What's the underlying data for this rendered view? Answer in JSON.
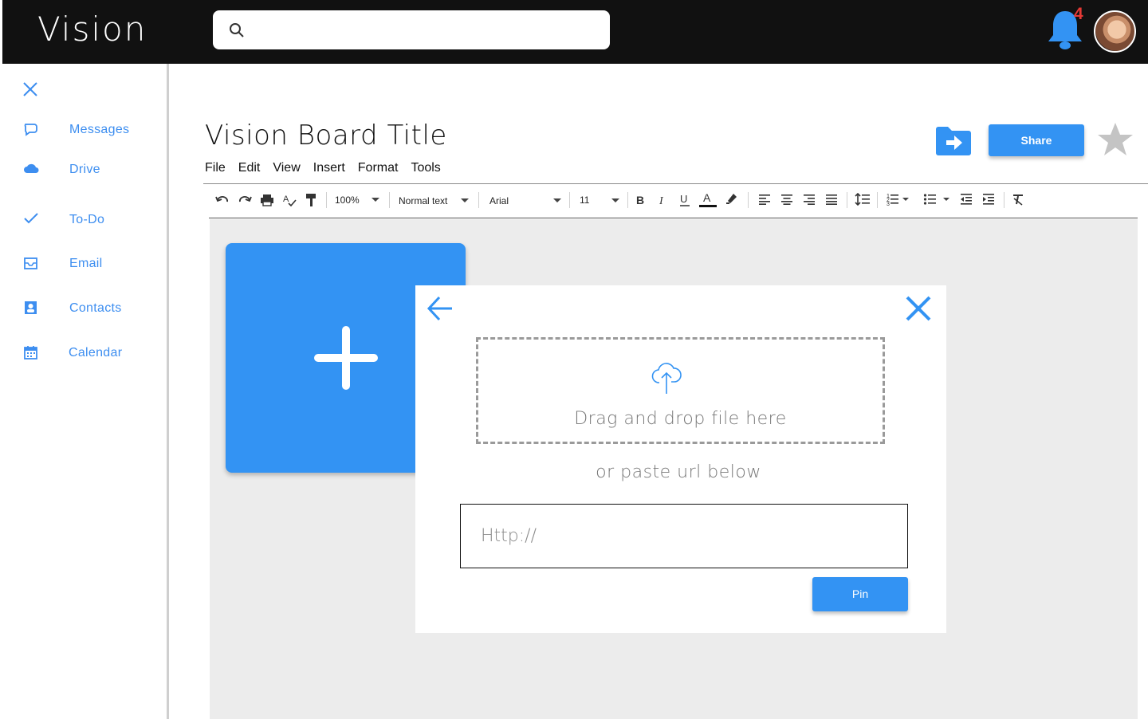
{
  "app": {
    "logo": "Vision",
    "notification_count": "4"
  },
  "search": {
    "placeholder": ""
  },
  "sidebar": {
    "items": [
      {
        "label": "Messages",
        "icon": "chat-icon"
      },
      {
        "label": "Drive",
        "icon": "cloud-icon"
      },
      {
        "label": "To-Do",
        "icon": "check-icon"
      },
      {
        "label": "Email",
        "icon": "inbox-icon"
      },
      {
        "label": "Contacts",
        "icon": "contact-card-icon"
      },
      {
        "label": "Calendar",
        "icon": "calendar-icon"
      }
    ]
  },
  "document": {
    "title": "Vision Board Title",
    "menu": [
      "File",
      "Edit",
      "View",
      "Insert",
      "Format",
      "Tools"
    ],
    "share_label": "Share"
  },
  "toolbar": {
    "zoom": "100%",
    "style": "Normal text",
    "font": "Arial",
    "font_size": "11"
  },
  "modal": {
    "drop_text": "Drag and drop file here",
    "or_text": "or paste url below",
    "url_placeholder": "Http://",
    "pin_label": "Pin"
  },
  "colors": {
    "accent": "#3393f3",
    "topbar": "#111111",
    "badge": "#e53935",
    "canvas": "#ececec"
  }
}
